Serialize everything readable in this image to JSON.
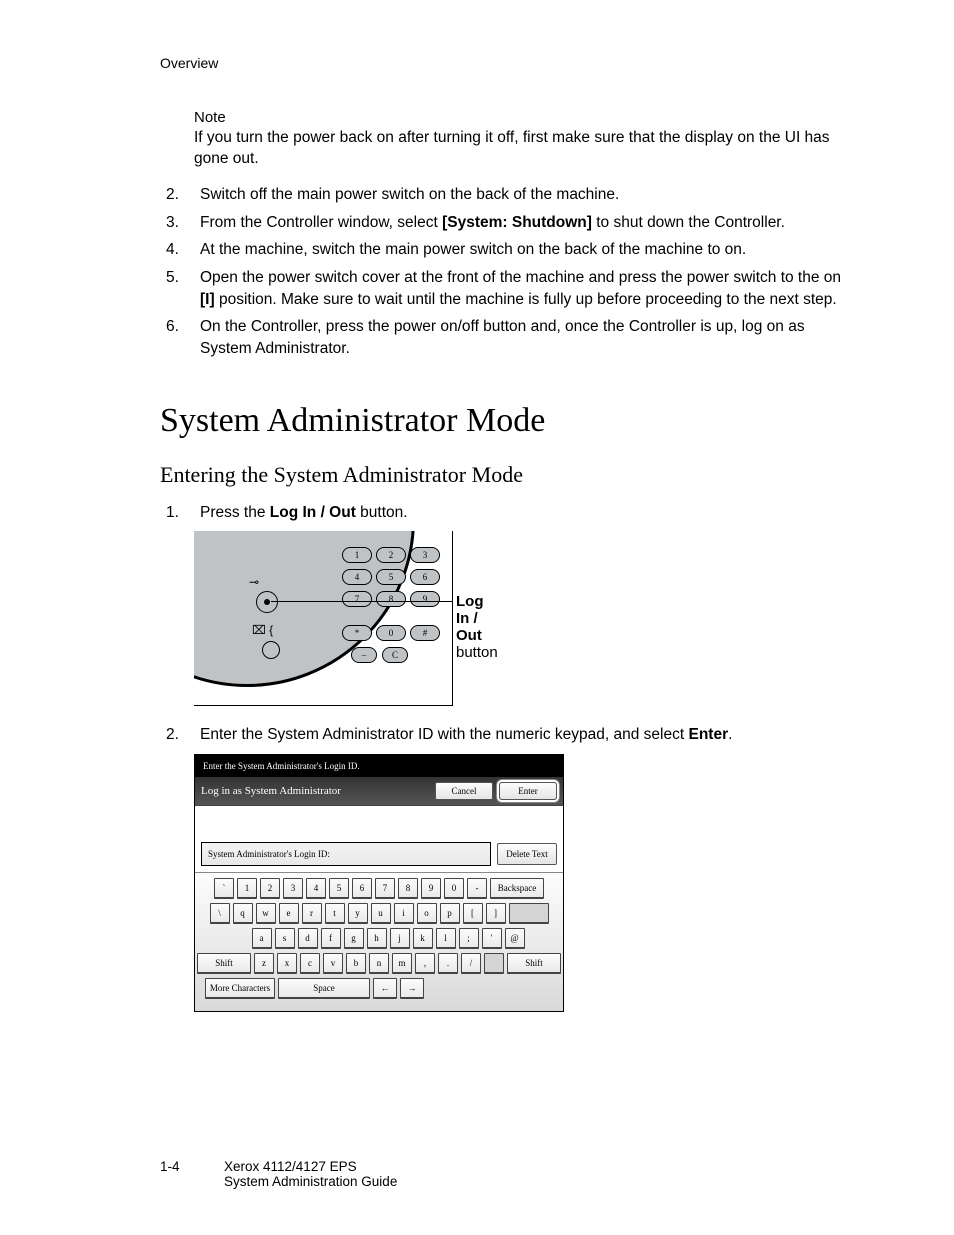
{
  "header": "Overview",
  "note": {
    "label": "Note",
    "text": "If you turn the power back on after turning it off, first make sure that the display on the UI has gone out."
  },
  "steps_a": [
    {
      "n": "2.",
      "pre": "Switch off the main power switch on the back of the machine."
    },
    {
      "n": "3.",
      "pre": "From the Controller window, select ",
      "bold": "[System: Shutdown]",
      "post": " to shut down the Controller."
    },
    {
      "n": "4.",
      "pre": "At the machine, switch the main power switch on the back of the machine to on."
    },
    {
      "n": "5.",
      "pre": "Open the power switch cover at the front of the machine and press the power switch to the on ",
      "bold": "[I]",
      "post": " position. Make sure to wait until the machine is fully up before proceeding to the next step."
    },
    {
      "n": "6.",
      "pre": "On the Controller, press the power on/off button and, once the Controller is up, log on as System Administrator."
    }
  ],
  "section_title": "System Administrator Mode",
  "subsection_title": "Entering the System Administrator Mode",
  "steps_b": {
    "s1": {
      "n": "1.",
      "pre": "Press the ",
      "bold": "Log In / Out",
      "post": " button."
    },
    "s2": {
      "n": "2.",
      "pre": "Enter the System Administrator ID with the numeric keypad, and select ",
      "bold": "Enter",
      "post": "."
    }
  },
  "callout": {
    "bold": "Log In / Out",
    "plain": "button"
  },
  "keypad": {
    "r1": [
      "1",
      "2",
      "3"
    ],
    "r2": [
      "4",
      "5",
      "6"
    ],
    "r3": [
      "7",
      "8",
      "9"
    ],
    "r4": [
      "*",
      "0",
      "#"
    ],
    "r5l": "–",
    "r5r": "C"
  },
  "login_screen": {
    "instruction": "Enter the System Administrator's Login ID.",
    "title": "Log in as System Administrator",
    "cancel": "Cancel",
    "enter": "Enter",
    "id_label": "System Administrator's Login ID:",
    "delete": "Delete Text",
    "rows": {
      "r1": [
        "`",
        "1",
        "2",
        "3",
        "4",
        "5",
        "6",
        "7",
        "8",
        "9",
        "0",
        "-"
      ],
      "backspace": "Backspace",
      "r2": [
        "\\",
        "q",
        "w",
        "e",
        "r",
        "t",
        "y",
        "u",
        "i",
        "o",
        "p",
        "[",
        "]"
      ],
      "r3": [
        "a",
        "s",
        "d",
        "f",
        "g",
        "h",
        "j",
        "k",
        "l",
        ";",
        "'",
        "@"
      ],
      "shift": "Shift",
      "r4": [
        "z",
        "x",
        "c",
        "v",
        "b",
        "n",
        "m",
        ",",
        ".",
        "/"
      ],
      "more": "More Characters",
      "space": "Space",
      "left": "←",
      "right": "→"
    }
  },
  "footer": {
    "page": "1-4",
    "line1": "Xerox 4112/4127 EPS",
    "line2": "System Administration Guide"
  }
}
